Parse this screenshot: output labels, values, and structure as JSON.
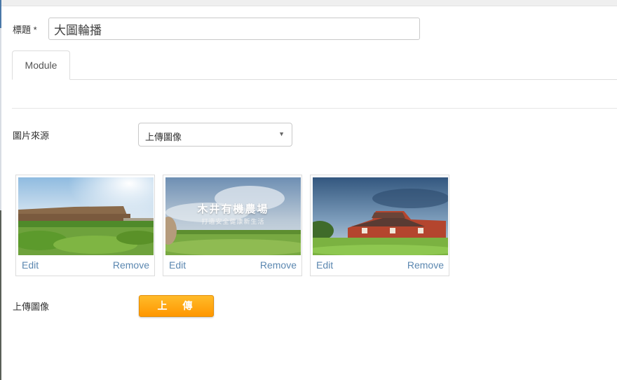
{
  "form": {
    "title_label": "標題 *",
    "title_value": "大圖輪播",
    "tab_module": "Module",
    "image_source_label": "圖片來源",
    "image_source_value": "上傳圖像",
    "upload_label": "上傳圖像",
    "upload_button": "上　傳"
  },
  "images": [
    {
      "edit": "Edit",
      "remove": "Remove",
      "scene": "farm-buildings-field-icon"
    },
    {
      "edit": "Edit",
      "remove": "Remove",
      "scene": "farm-banner-image",
      "overlay_title": "木井有機農場",
      "overlay_subtitle": "打造安全健康新生活"
    },
    {
      "edit": "Edit",
      "remove": "Remove",
      "scene": "red-barn-field-icon"
    }
  ],
  "colors": {
    "link": "#5b87b0",
    "upload_button": "#ff9f10",
    "border": "#c9c9c9"
  }
}
